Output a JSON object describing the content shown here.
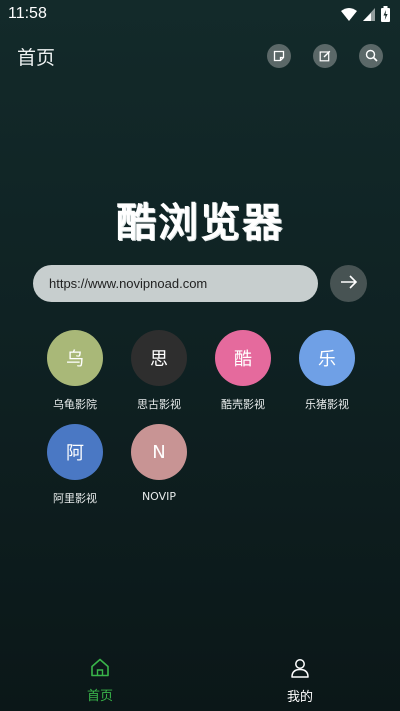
{
  "status_bar": {
    "time": "11:58"
  },
  "header": {
    "title": "首页",
    "actions": [
      {
        "icon": "bookmark-icon"
      },
      {
        "icon": "edit-icon"
      },
      {
        "icon": "search-icon"
      }
    ]
  },
  "logo": {
    "text": "酷浏览器"
  },
  "url_bar": {
    "value": "https://www.novipnoad.com"
  },
  "sites": [
    {
      "initial": "乌",
      "name": "乌龟影院",
      "color": "#a9b878"
    },
    {
      "initial": "思",
      "name": "思古影视",
      "color": "#2e2e2e"
    },
    {
      "initial": "酷",
      "name": "酷壳影视",
      "color": "#e56a9d"
    },
    {
      "initial": "乐",
      "name": "乐猪影视",
      "color": "#6fa0e6"
    },
    {
      "initial": "阿",
      "name": "阿里影视",
      "color": "#4a78c4"
    },
    {
      "initial": "N",
      "name": "NOVIP",
      "color": "#c89494"
    }
  ],
  "bottom_nav": {
    "home_label": "首页",
    "me_label": "我的",
    "active_color": "#39b54a"
  }
}
